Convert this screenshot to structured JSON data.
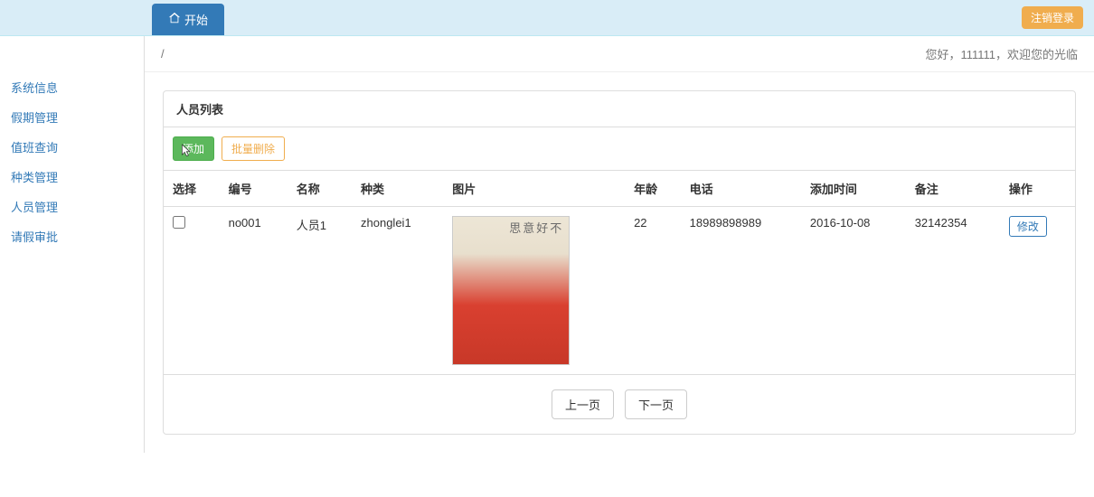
{
  "topbar": {
    "start_tab": "开始",
    "logout": "注销登录"
  },
  "sidebar": {
    "items": [
      {
        "label": "系统信息"
      },
      {
        "label": "假期管理"
      },
      {
        "label": "值班查询"
      },
      {
        "label": "种类管理"
      },
      {
        "label": "人员管理"
      },
      {
        "label": "请假审批"
      }
    ]
  },
  "breadcrumb": "/",
  "welcome": "您好，111111，欢迎您的光临",
  "panel": {
    "title": "人员列表",
    "add_btn": "添加",
    "batch_delete_btn": "批量删除",
    "columns": {
      "select": "选择",
      "code": "编号",
      "name": "名称",
      "category": "种类",
      "image": "图片",
      "age": "年龄",
      "phone": "电话",
      "add_time": "添加时间",
      "remark": "备注",
      "action": "操作"
    },
    "rows": [
      {
        "code": "no001",
        "name": "人员1",
        "category": "zhonglei1",
        "image_caption": "不好意思",
        "age": "22",
        "phone": "18989898989",
        "add_time": "2016-10-08",
        "remark": "32142354",
        "edit_label": "修改"
      }
    ],
    "pager": {
      "prev": "上一页",
      "next": "下一页"
    }
  }
}
